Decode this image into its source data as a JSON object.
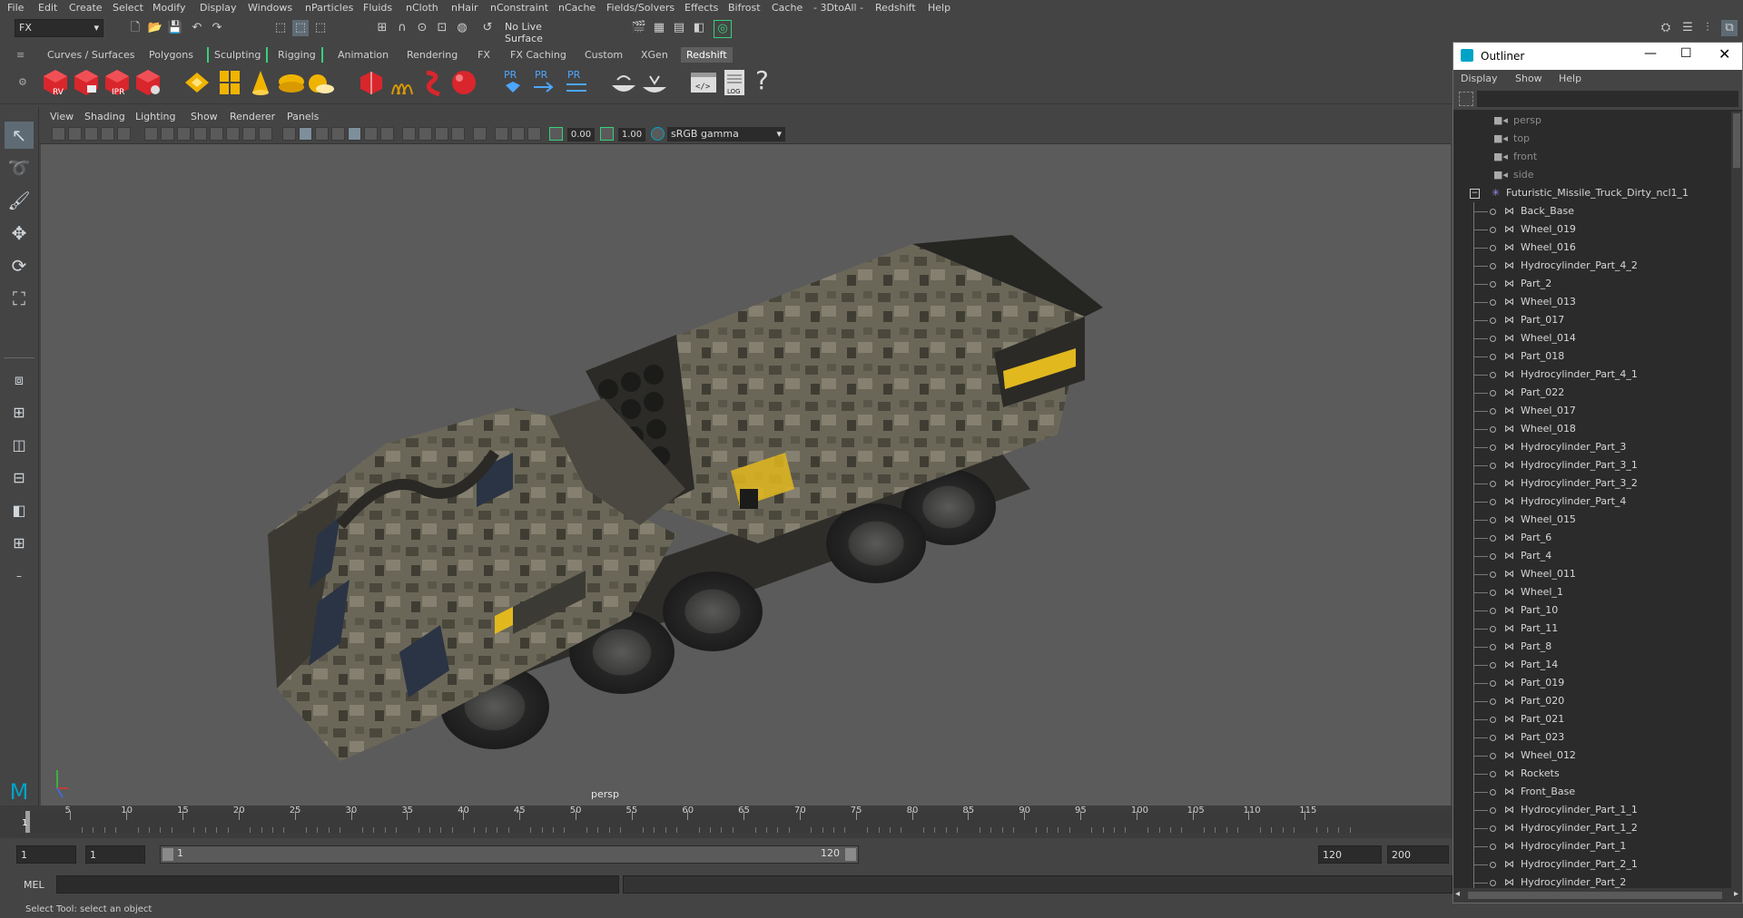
{
  "menubar": {
    "items": [
      "File",
      "Edit",
      "Create",
      "Select",
      "Modify",
      "Display",
      "Windows",
      "nParticles",
      "Fluids",
      "nCloth",
      "nHair",
      "nConstraint",
      "nCache",
      "Fields/Solvers",
      "Effects",
      "Bifrost",
      "Cache",
      "- 3DtoAll -",
      "Redshift",
      "Help"
    ]
  },
  "statusline": {
    "menuset": "FX",
    "live_surface": "No Live Surface"
  },
  "shelf_tabs": [
    "Curves / Surfaces",
    "Polygons",
    "Sculpting",
    "Rigging",
    "Animation",
    "Rendering",
    "FX",
    "FX Caching",
    "Custom",
    "XGen",
    "Redshift"
  ],
  "shelf_active": "Redshift",
  "shelf": {
    "rv_label": "RV",
    "ipr_label": "IPR",
    "pr_label": "PR",
    "log_label": "LOG",
    "help_glyph": "?"
  },
  "viewport": {
    "menu": [
      "View",
      "Shading",
      "Lighting",
      "Show",
      "Renderer",
      "Panels"
    ],
    "exposure": "0.00",
    "gamma": "1.00",
    "color_space": "sRGB gamma",
    "camera_label": "persp"
  },
  "timeline": {
    "ticks": [
      "5",
      "10",
      "15",
      "20",
      "25",
      "30",
      "35",
      "40",
      "45",
      "50",
      "55",
      "60",
      "65",
      "70",
      "75",
      "80",
      "85",
      "90",
      "95",
      "100",
      "105",
      "110",
      "115"
    ],
    "current_frame": "1"
  },
  "range": {
    "start": "1",
    "anim_start": "1",
    "range_start": "1",
    "range_end": "120",
    "end": "120",
    "anim_end": "200"
  },
  "command_line": {
    "lang": "MEL"
  },
  "help_line": "Select Tool: select an object",
  "outliner": {
    "title": "Outliner",
    "menu": [
      "Display",
      "Show",
      "Help"
    ],
    "cameras": [
      "persp",
      "top",
      "front",
      "side"
    ],
    "root": "Futuristic_Missile_Truck_Dirty_ncl1_1",
    "children": [
      "Back_Base",
      "Wheel_019",
      "Wheel_016",
      "Hydrocylinder_Part_4_2",
      "Part_2",
      "Wheel_013",
      "Part_017",
      "Wheel_014",
      "Part_018",
      "Hydrocylinder_Part_4_1",
      "Part_022",
      "Wheel_017",
      "Wheel_018",
      "Hydrocylinder_Part_3",
      "Hydrocylinder_Part_3_1",
      "Hydrocylinder_Part_3_2",
      "Hydrocylinder_Part_4",
      "Wheel_015",
      "Part_6",
      "Part_4",
      "Wheel_011",
      "Wheel_1",
      "Part_10",
      "Part_11",
      "Part_8",
      "Part_14",
      "Part_019",
      "Part_020",
      "Part_021",
      "Part_023",
      "Wheel_012",
      "Rockets",
      "Front_Base",
      "Hydrocylinder_Part_1_1",
      "Hydrocylinder_Part_1_2",
      "Hydrocylinder_Part_1",
      "Hydrocylinder_Part_2_1",
      "Hydrocylinder_Part_2"
    ]
  },
  "colors": {
    "accent": "#00a3c7",
    "redshift_red": "#d8262c",
    "shelf_yellow": "#f0b400",
    "camo_dark": "#3d3a32",
    "camo_light": "#7a7666"
  }
}
